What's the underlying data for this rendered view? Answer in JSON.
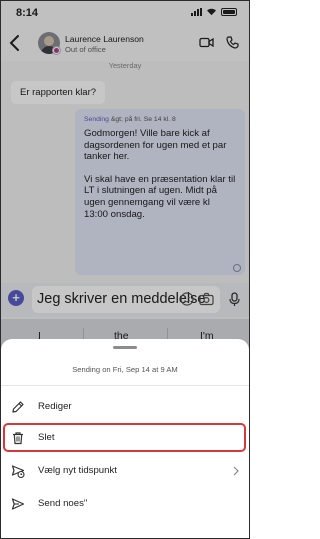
{
  "status_bar": {
    "time": "8:14"
  },
  "header": {
    "contact_name": "Laurence Laurenson",
    "contact_status": "Out of office"
  },
  "chat": {
    "day_label": "Yesterday",
    "incoming_message": "Er rapporten klar?",
    "outgoing": {
      "scheduled_label": "Sending",
      "scheduled_info": "&gt; på fri. Se 14 kl. 8",
      "paragraph1": "Godmorgen! Ville bare kick af dagsordenen for ugen med et par tanker her.",
      "paragraph2": "Vi skal have en præsentation klar til LT i slutningen af ugen. Midt på ugen gennemgang vil være kl 13:00 onsdag."
    }
  },
  "composer": {
    "text": "Jeg skriver en meddelelse"
  },
  "keyboard": {
    "suggestions": [
      "I",
      "the",
      "I'm"
    ]
  },
  "sheet": {
    "title": "Sending on Fri, Sep 14 at 9 AM",
    "items": [
      {
        "label": "Rediger",
        "icon": "pencil-icon"
      },
      {
        "label": "Slet",
        "icon": "trash-icon"
      },
      {
        "label": "Vælg nyt tidspunkt",
        "icon": "reschedule-send-icon"
      },
      {
        "label": "Send noes\"",
        "icon": "send-icon"
      }
    ]
  },
  "colors": {
    "accent": "#5b5fc7",
    "highlight": "#d7383c"
  }
}
